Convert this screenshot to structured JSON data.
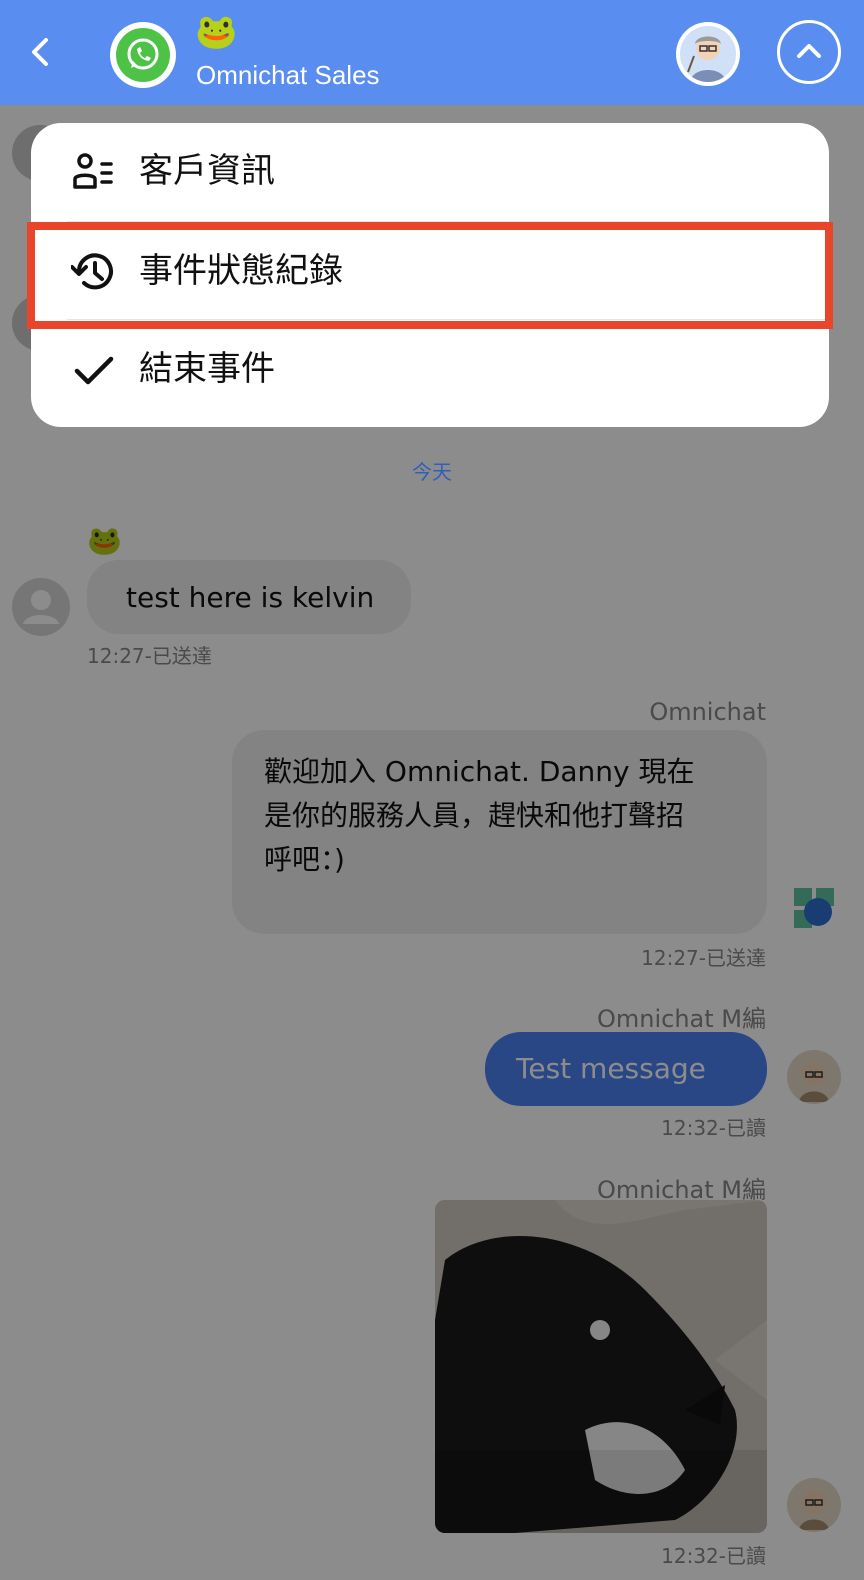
{
  "header": {
    "back_icon": "chevron-left-icon",
    "channel_icon": "whatsapp-icon",
    "emoji": "🐸",
    "channel_name": "Omnichat Sales",
    "collapse_icon": "chevron-up-icon",
    "color": "#5a8df0"
  },
  "menu": {
    "items": [
      {
        "icon": "contact-info-icon",
        "label": "客戶資訊"
      },
      {
        "icon": "history-icon",
        "label": "事件狀態紀錄"
      },
      {
        "icon": "check-icon",
        "label": "結束事件"
      }
    ],
    "highlight_color": "#e8452b"
  },
  "chat": {
    "date_divider": "今天",
    "messages": [
      {
        "emoji": "🐸",
        "text": "test here is kelvin",
        "time": "12:27-已送達"
      },
      {
        "sender": "Omnichat",
        "text": "歡迎加入 Omnichat. Danny 現在是你的服務人員，趕快和他打聲招呼吧：)",
        "line1": "歡迎加入 Omnichat. Danny 現在",
        "line2": "是你的服務人員，趕快和他打聲招",
        "line3": "呼吧：)",
        "time": "12:27-已送達"
      },
      {
        "sender": "Omnichat M編",
        "text": "Test message",
        "time": "12:32-已讀"
      },
      {
        "sender": "Omnichat M編",
        "image": "cat-photo",
        "time": "12:32-已讀"
      }
    ]
  }
}
